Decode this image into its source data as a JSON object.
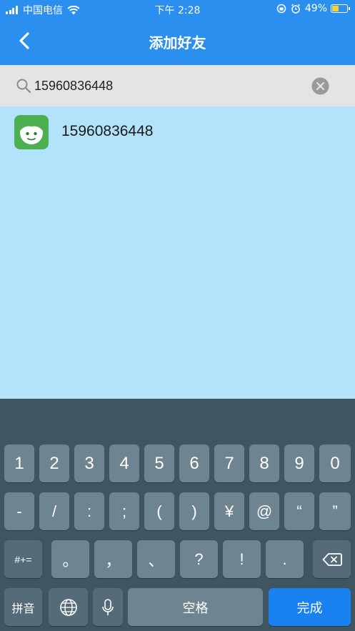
{
  "status": {
    "carrier": "中国电信",
    "time": "下午 2:28",
    "battery": "49%",
    "battery_level": 0.49
  },
  "nav": {
    "title": "添加好友",
    "back_icon": "chevron-left-icon"
  },
  "search": {
    "value": "15960836448",
    "icon": "search-icon",
    "clear_icon": "clear-icon"
  },
  "result": {
    "name": "15960836448",
    "avatar_icon": "face-avatar-icon"
  },
  "keyboard": {
    "row1": [
      "1",
      "2",
      "3",
      "4",
      "5",
      "6",
      "7",
      "8",
      "9",
      "0"
    ],
    "row2": [
      "-",
      "/",
      ":",
      ";",
      "(",
      ")",
      "¥",
      "@",
      "“",
      "”"
    ],
    "symbols_toggle": "#+=",
    "row3": [
      "。",
      "，",
      "、",
      "?",
      "!",
      "."
    ],
    "pinyin": "拼音",
    "space": "空格",
    "done": "完成"
  }
}
